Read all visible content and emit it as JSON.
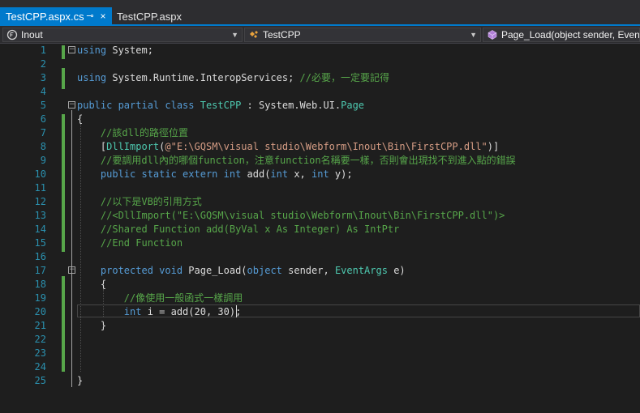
{
  "tabs": [
    {
      "label": "TestCPP.aspx.cs",
      "active": true
    },
    {
      "label": "TestCPP.aspx",
      "active": false
    }
  ],
  "tab_icons": {
    "pin": "pin-icon",
    "close": "close-icon"
  },
  "nav": {
    "project": {
      "label": "Inout",
      "icon": "csharp-project-icon"
    },
    "type": {
      "label": "TestCPP",
      "icon": "class-icon"
    },
    "member": {
      "label": "Page_Load(object sender, EventArgs e)",
      "icon": "method-icon"
    }
  },
  "editor": {
    "current_line": 20,
    "colors": {
      "keyword": "#569cd6",
      "type": "#4ec9b0",
      "comment": "#57a64a",
      "string": "#d69d85",
      "text": "#dcdcdc",
      "line_number": "#2b91af",
      "background": "#1e1e1e",
      "tab_active": "#007acc"
    },
    "lines": [
      {
        "num": "1",
        "segments": [
          {
            "t": "using",
            "c": "kw"
          },
          {
            "t": " System;",
            "c": ""
          }
        ]
      },
      {
        "num": "2",
        "segments": []
      },
      {
        "num": "3",
        "segments": [
          {
            "t": "using",
            "c": "kw"
          },
          {
            "t": " System.Runtime.InteropServices; ",
            "c": ""
          },
          {
            "t": "//必要，一定要記得",
            "c": "cm"
          }
        ]
      },
      {
        "num": "4",
        "segments": []
      },
      {
        "num": "5",
        "segments": [
          {
            "t": "public partial class ",
            "c": "kw"
          },
          {
            "t": "TestCPP",
            "c": "ty"
          },
          {
            "t": " : System.Web.UI.",
            "c": ""
          },
          {
            "t": "Page",
            "c": "ty"
          }
        ]
      },
      {
        "num": "6",
        "segments": [
          {
            "t": "{",
            "c": ""
          }
        ]
      },
      {
        "num": "7",
        "segments": [
          {
            "t": "    //該dll的路徑位置",
            "c": "cm"
          }
        ]
      },
      {
        "num": "8",
        "segments": [
          {
            "t": "    [",
            "c": ""
          },
          {
            "t": "DllImport",
            "c": "ty"
          },
          {
            "t": "(",
            "c": ""
          },
          {
            "t": "@\"E:\\GQSM\\visual studio\\Webform\\Inout\\Bin\\FirstCPP.dll\"",
            "c": "st"
          },
          {
            "t": ")]",
            "c": ""
          }
        ]
      },
      {
        "num": "9",
        "segments": [
          {
            "t": "    //要調用dll內的哪個function，注意function名稱要一樣，否則會出現找不到進入點的錯誤",
            "c": "cm"
          }
        ]
      },
      {
        "num": "10",
        "segments": [
          {
            "t": "    ",
            "c": ""
          },
          {
            "t": "public static extern int",
            "c": "kw"
          },
          {
            "t": " add(",
            "c": ""
          },
          {
            "t": "int",
            "c": "kw"
          },
          {
            "t": " x, ",
            "c": ""
          },
          {
            "t": "int",
            "c": "kw"
          },
          {
            "t": " y);",
            "c": ""
          }
        ]
      },
      {
        "num": "11",
        "segments": []
      },
      {
        "num": "12",
        "segments": [
          {
            "t": "    //以下是VB的引用方式",
            "c": "cm"
          }
        ]
      },
      {
        "num": "13",
        "segments": [
          {
            "t": "    //<DllImport(\"E:\\GQSM\\visual studio\\Webform\\Inout\\Bin\\FirstCPP.dll\")>",
            "c": "cm"
          }
        ]
      },
      {
        "num": "14",
        "segments": [
          {
            "t": "    //Shared Function add(ByVal x As Integer) As IntPtr",
            "c": "cm"
          }
        ]
      },
      {
        "num": "15",
        "segments": [
          {
            "t": "    //End Function",
            "c": "cm"
          }
        ]
      },
      {
        "num": "16",
        "segments": []
      },
      {
        "num": "17",
        "segments": [
          {
            "t": "    ",
            "c": ""
          },
          {
            "t": "protected void",
            "c": "kw"
          },
          {
            "t": " Page_Load(",
            "c": ""
          },
          {
            "t": "object",
            "c": "kw"
          },
          {
            "t": " sender, ",
            "c": ""
          },
          {
            "t": "EventArgs",
            "c": "ty"
          },
          {
            "t": " e)",
            "c": ""
          }
        ]
      },
      {
        "num": "18",
        "segments": [
          {
            "t": "    {",
            "c": ""
          }
        ]
      },
      {
        "num": "19",
        "segments": [
          {
            "t": "        //像使用一般函式一樣調用",
            "c": "cm"
          }
        ]
      },
      {
        "num": "20",
        "segments": [
          {
            "t": "        ",
            "c": ""
          },
          {
            "t": "int",
            "c": "kw"
          },
          {
            "t": " i = add(20, 30);",
            "c": ""
          }
        ]
      },
      {
        "num": "21",
        "segments": [
          {
            "t": "    }",
            "c": ""
          }
        ]
      },
      {
        "num": "22",
        "segments": []
      },
      {
        "num": "23",
        "segments": []
      },
      {
        "num": "24",
        "segments": []
      },
      {
        "num": "25",
        "segments": [
          {
            "t": "}",
            "c": ""
          }
        ]
      }
    ]
  }
}
